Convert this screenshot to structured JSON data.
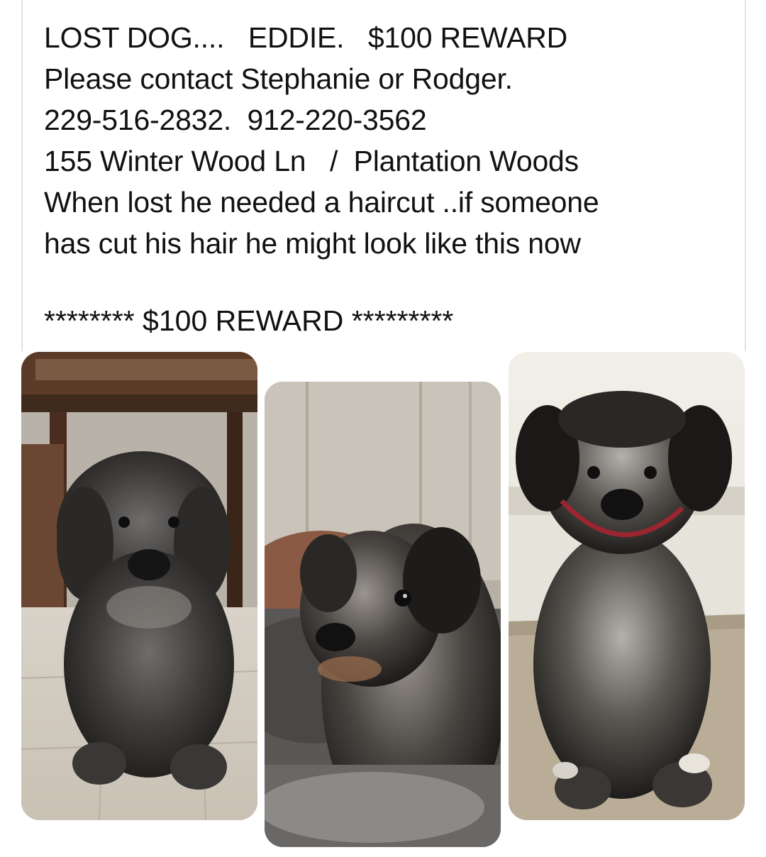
{
  "post": {
    "lines": [
      "LOST DOG....   EDDIE.   $100 REWARD",
      "Please contact Stephanie or Rodger.",
      "229-516-2832.  912-220-3562",
      "155 Winter Wood Ln   /  Plantation Woods",
      "When lost he needed a haircut ..if someone",
      "has cut his hair he might look like this now"
    ],
    "reward_line": "******** $100 REWARD *********"
  },
  "photos": [
    {
      "subject": "dog-shaggy-sitting-under-chair"
    },
    {
      "subject": "dog-closeup-on-couch"
    },
    {
      "subject": "dog-trimmed-sitting-on-rug"
    }
  ]
}
